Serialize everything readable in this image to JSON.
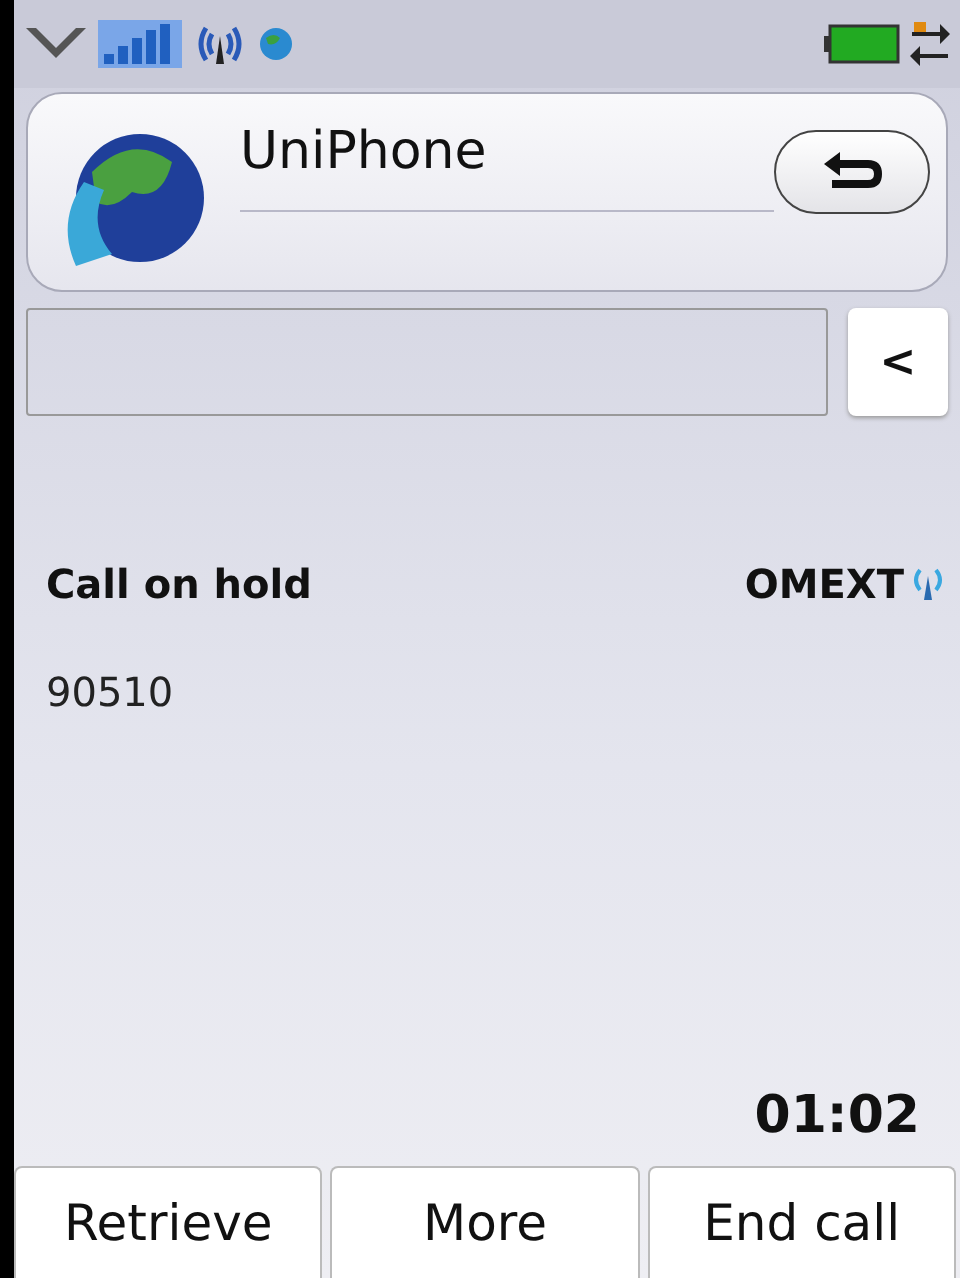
{
  "app": {
    "title": "UniPhone"
  },
  "dial": {
    "backspace": "<"
  },
  "call": {
    "status": "Call on hold",
    "line": "OMEXT",
    "number": "90510",
    "duration": "01:02"
  },
  "buttons": [
    {
      "label": "Retrieve"
    },
    {
      "label": "More"
    },
    {
      "label": "End call"
    }
  ]
}
